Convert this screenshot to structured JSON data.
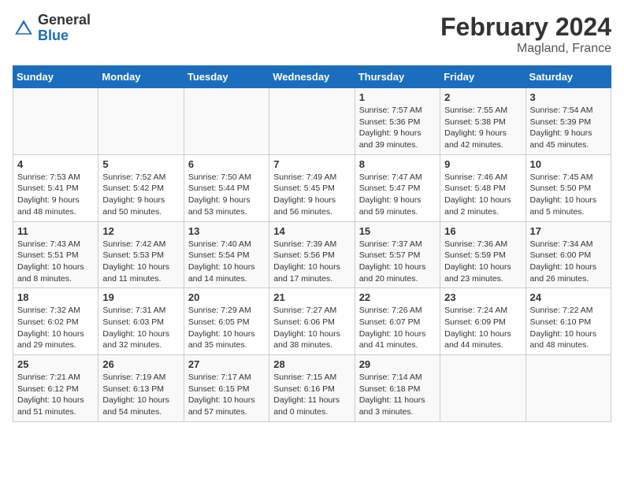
{
  "header": {
    "logo": {
      "general": "General",
      "blue": "Blue"
    },
    "title": "February 2024",
    "subtitle": "Magland, France"
  },
  "calendar": {
    "days_of_week": [
      "Sunday",
      "Monday",
      "Tuesday",
      "Wednesday",
      "Thursday",
      "Friday",
      "Saturday"
    ],
    "weeks": [
      [
        {
          "day": "",
          "info": ""
        },
        {
          "day": "",
          "info": ""
        },
        {
          "day": "",
          "info": ""
        },
        {
          "day": "",
          "info": ""
        },
        {
          "day": "1",
          "info": "Sunrise: 7:57 AM\nSunset: 5:36 PM\nDaylight: 9 hours and 39 minutes."
        },
        {
          "day": "2",
          "info": "Sunrise: 7:55 AM\nSunset: 5:38 PM\nDaylight: 9 hours and 42 minutes."
        },
        {
          "day": "3",
          "info": "Sunrise: 7:54 AM\nSunset: 5:39 PM\nDaylight: 9 hours and 45 minutes."
        }
      ],
      [
        {
          "day": "4",
          "info": "Sunrise: 7:53 AM\nSunset: 5:41 PM\nDaylight: 9 hours and 48 minutes."
        },
        {
          "day": "5",
          "info": "Sunrise: 7:52 AM\nSunset: 5:42 PM\nDaylight: 9 hours and 50 minutes."
        },
        {
          "day": "6",
          "info": "Sunrise: 7:50 AM\nSunset: 5:44 PM\nDaylight: 9 hours and 53 minutes."
        },
        {
          "day": "7",
          "info": "Sunrise: 7:49 AM\nSunset: 5:45 PM\nDaylight: 9 hours and 56 minutes."
        },
        {
          "day": "8",
          "info": "Sunrise: 7:47 AM\nSunset: 5:47 PM\nDaylight: 9 hours and 59 minutes."
        },
        {
          "day": "9",
          "info": "Sunrise: 7:46 AM\nSunset: 5:48 PM\nDaylight: 10 hours and 2 minutes."
        },
        {
          "day": "10",
          "info": "Sunrise: 7:45 AM\nSunset: 5:50 PM\nDaylight: 10 hours and 5 minutes."
        }
      ],
      [
        {
          "day": "11",
          "info": "Sunrise: 7:43 AM\nSunset: 5:51 PM\nDaylight: 10 hours and 8 minutes."
        },
        {
          "day": "12",
          "info": "Sunrise: 7:42 AM\nSunset: 5:53 PM\nDaylight: 10 hours and 11 minutes."
        },
        {
          "day": "13",
          "info": "Sunrise: 7:40 AM\nSunset: 5:54 PM\nDaylight: 10 hours and 14 minutes."
        },
        {
          "day": "14",
          "info": "Sunrise: 7:39 AM\nSunset: 5:56 PM\nDaylight: 10 hours and 17 minutes."
        },
        {
          "day": "15",
          "info": "Sunrise: 7:37 AM\nSunset: 5:57 PM\nDaylight: 10 hours and 20 minutes."
        },
        {
          "day": "16",
          "info": "Sunrise: 7:36 AM\nSunset: 5:59 PM\nDaylight: 10 hours and 23 minutes."
        },
        {
          "day": "17",
          "info": "Sunrise: 7:34 AM\nSunset: 6:00 PM\nDaylight: 10 hours and 26 minutes."
        }
      ],
      [
        {
          "day": "18",
          "info": "Sunrise: 7:32 AM\nSunset: 6:02 PM\nDaylight: 10 hours and 29 minutes."
        },
        {
          "day": "19",
          "info": "Sunrise: 7:31 AM\nSunset: 6:03 PM\nDaylight: 10 hours and 32 minutes."
        },
        {
          "day": "20",
          "info": "Sunrise: 7:29 AM\nSunset: 6:05 PM\nDaylight: 10 hours and 35 minutes."
        },
        {
          "day": "21",
          "info": "Sunrise: 7:27 AM\nSunset: 6:06 PM\nDaylight: 10 hours and 38 minutes."
        },
        {
          "day": "22",
          "info": "Sunrise: 7:26 AM\nSunset: 6:07 PM\nDaylight: 10 hours and 41 minutes."
        },
        {
          "day": "23",
          "info": "Sunrise: 7:24 AM\nSunset: 6:09 PM\nDaylight: 10 hours and 44 minutes."
        },
        {
          "day": "24",
          "info": "Sunrise: 7:22 AM\nSunset: 6:10 PM\nDaylight: 10 hours and 48 minutes."
        }
      ],
      [
        {
          "day": "25",
          "info": "Sunrise: 7:21 AM\nSunset: 6:12 PM\nDaylight: 10 hours and 51 minutes."
        },
        {
          "day": "26",
          "info": "Sunrise: 7:19 AM\nSunset: 6:13 PM\nDaylight: 10 hours and 54 minutes."
        },
        {
          "day": "27",
          "info": "Sunrise: 7:17 AM\nSunset: 6:15 PM\nDaylight: 10 hours and 57 minutes."
        },
        {
          "day": "28",
          "info": "Sunrise: 7:15 AM\nSunset: 6:16 PM\nDaylight: 11 hours and 0 minutes."
        },
        {
          "day": "29",
          "info": "Sunrise: 7:14 AM\nSunset: 6:18 PM\nDaylight: 11 hours and 3 minutes."
        },
        {
          "day": "",
          "info": ""
        },
        {
          "day": "",
          "info": ""
        }
      ]
    ]
  }
}
